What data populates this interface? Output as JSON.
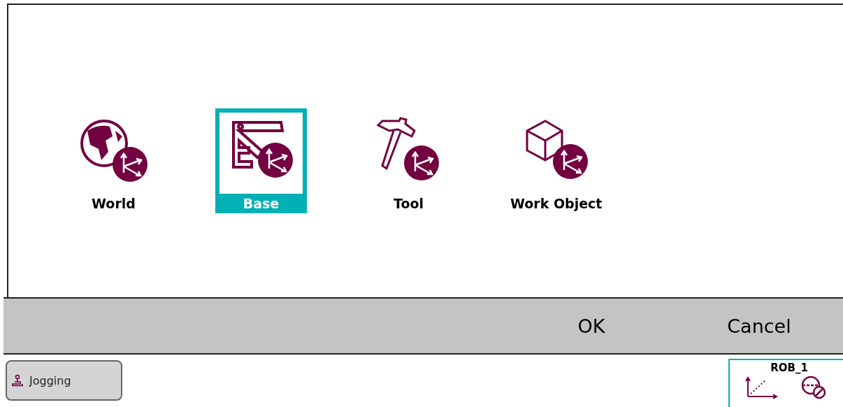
{
  "frames": [
    {
      "kind": "world",
      "label": "World",
      "selected": false
    },
    {
      "kind": "base",
      "label": "Base",
      "selected": true
    },
    {
      "kind": "tool",
      "label": "Tool",
      "selected": false
    },
    {
      "kind": "workobject",
      "label": "Work Object",
      "selected": false
    }
  ],
  "buttons": [
    "OK",
    "Cancel"
  ],
  "taskbar": {
    "jogging": "Jogging",
    "robot": "ROB_1"
  }
}
